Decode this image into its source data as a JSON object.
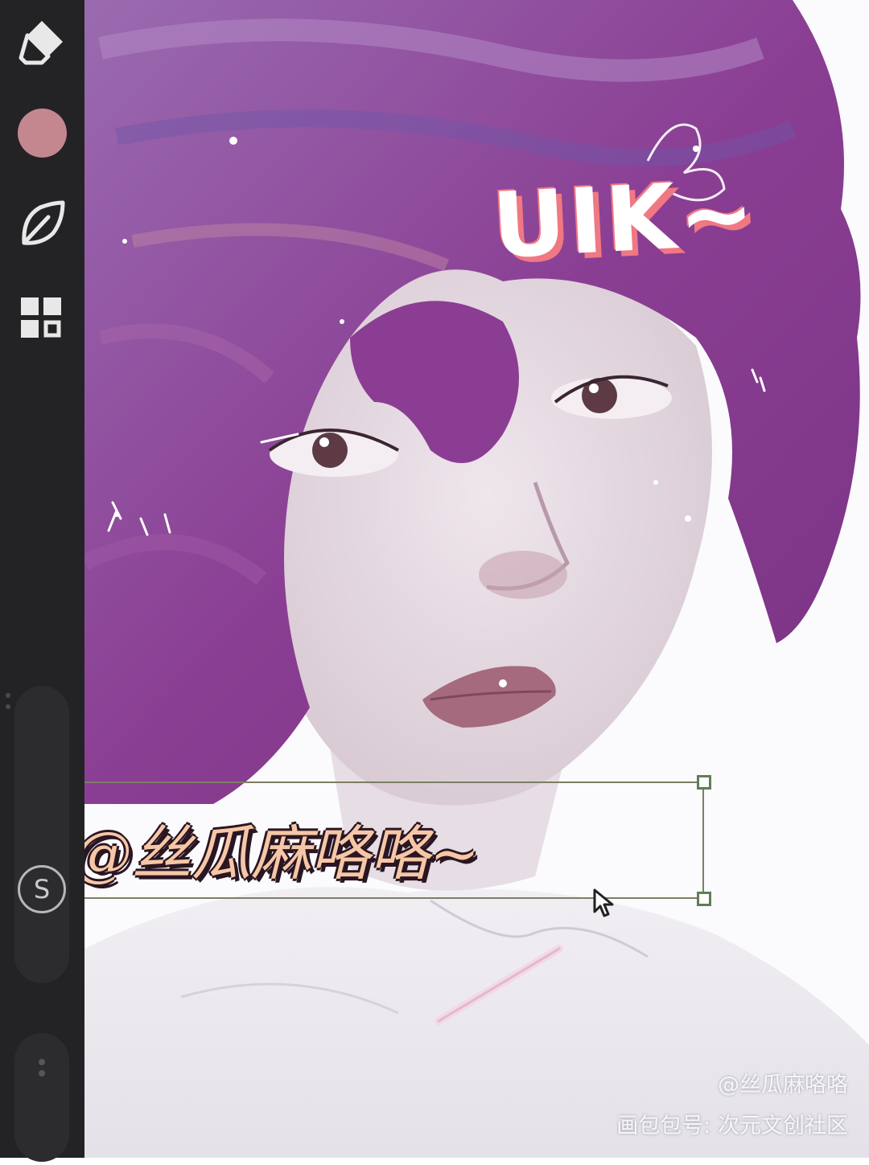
{
  "toolbar": {
    "tools": [
      {
        "name": "eraser",
        "icon": "eraser-icon"
      },
      {
        "name": "color",
        "icon": "color-swatch"
      },
      {
        "name": "brush",
        "icon": "leaf-brush-icon"
      },
      {
        "name": "menu",
        "icon": "grid-menu-icon"
      }
    ],
    "current_color": "#c5878f",
    "modify_button_label": "S"
  },
  "canvas": {
    "title_sticker": "UIK~",
    "signature_text": "@丝瓜麻咯咯~"
  },
  "watermark": {
    "line1": "@丝瓜麻咯咯",
    "line2": "画包包号: 次元文创社区"
  },
  "colors": {
    "toolbar_bg": "#232325",
    "hair": "#8a3e93",
    "skin": "#e9e0e7",
    "title_shadow": "#f07883",
    "signature_fill": "#f6c7a6"
  }
}
